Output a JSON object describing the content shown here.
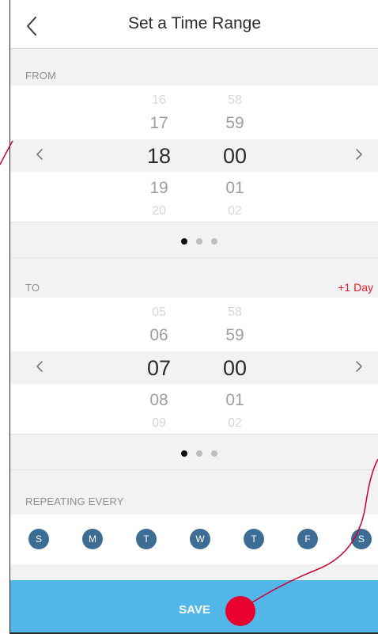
{
  "header": {
    "title": "Set a Time Range"
  },
  "from": {
    "label": "FROM",
    "hours": [
      "16",
      "17",
      "18",
      "19",
      "20"
    ],
    "minutes": [
      "58",
      "59",
      "00",
      "01",
      "02"
    ],
    "page_index": 0,
    "page_count": 3
  },
  "to": {
    "label": "TO",
    "extra": "+1 Day",
    "hours": [
      "05",
      "06",
      "07",
      "08",
      "09"
    ],
    "minutes": [
      "58",
      "59",
      "00",
      "01",
      "02"
    ],
    "page_index": 0,
    "page_count": 3
  },
  "repeat": {
    "label": "REPEATING EVERY",
    "days": [
      "S",
      "M",
      "T",
      "W",
      "T",
      "F",
      "S"
    ]
  },
  "save_label": "SAVE",
  "colors": {
    "accent_blue": "#52b6e8",
    "day_circle": "#3d6d94",
    "alert_red": "#e8192c",
    "annotation_red": "#cc0033"
  },
  "icons": {
    "back": "chevron-left-icon",
    "prev": "chevron-left-icon",
    "next": "chevron-right-icon"
  }
}
